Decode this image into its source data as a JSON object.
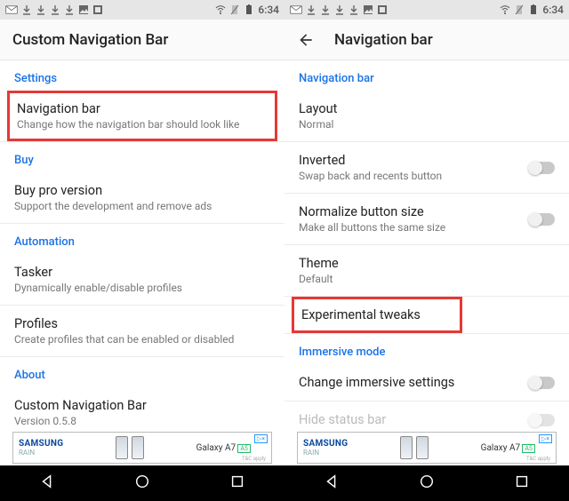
{
  "status": {
    "time": "6:34"
  },
  "left": {
    "title": "Custom Navigation Bar",
    "sections": {
      "settings": {
        "header": "Settings",
        "navbar": {
          "title": "Navigation bar",
          "sub": "Change how the navigation bar should look like"
        }
      },
      "buy": {
        "header": "Buy",
        "pro": {
          "title": "Buy pro version",
          "sub": "Support the development and remove ads"
        }
      },
      "automation": {
        "header": "Automation",
        "tasker": {
          "title": "Tasker",
          "sub": "Dynamically enable/disable profiles"
        },
        "profiles": {
          "title": "Profiles",
          "sub": "Create profiles that can be enabled or disabled"
        }
      },
      "about": {
        "header": "About",
        "app": {
          "title": "Custom Navigation Bar",
          "sub": "Version 0.5.8"
        }
      }
    }
  },
  "right": {
    "title": "Navigation bar",
    "sections": {
      "navbar": {
        "header": "Navigation bar",
        "layout": {
          "title": "Layout",
          "sub": "Normal"
        },
        "inverted": {
          "title": "Inverted",
          "sub": "Swap back and recents button"
        },
        "normalize": {
          "title": "Normalize button size",
          "sub": "Make all buttons the same size"
        },
        "theme": {
          "title": "Theme",
          "sub": "Default"
        },
        "experimental": {
          "title": "Experimental tweaks"
        }
      },
      "immersive": {
        "header": "Immersive mode",
        "change": {
          "title": "Change immersive settings"
        },
        "hide": {
          "title": "Hide status bar"
        }
      }
    }
  },
  "ad": {
    "brand": "SAMSUNG",
    "rain": "RAIN",
    "model": "Galaxy A7",
    "a": "A5",
    "badge": "▷×",
    "sub": "T&C apply"
  }
}
